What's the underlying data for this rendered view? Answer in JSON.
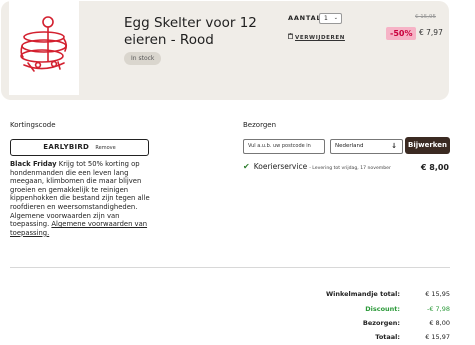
{
  "cart_item": {
    "product_name": "Egg Skelter voor 12 eieren - Rood",
    "stock_label": "In stock",
    "quantity_label": "AANTAL",
    "quantity_value": "1",
    "remove_label": "VERWIJDEREN",
    "old_price": "€ 15,95",
    "discount_badge": "-50%",
    "new_price": "€ 7,97",
    "image_icon": "egg-skelter-product-image",
    "image_color": "#d3202f"
  },
  "coupon": {
    "heading": "Kortingscode",
    "code": "EARLYBIRD",
    "remove_label": "Remove",
    "promo_bold": "Black Friday",
    "promo_text": " Krijg tot 50% korting op hondenmanden die een leven lang meegaan, klimbomen die maar blijven groeien en gemakkelijk te reinigen kippenhokken die bestand zijn tegen alle roofdieren en weersomstandigheden. Algemene voorwaarden zijn van toepassing. ",
    "promo_link": "Algemene voorwaarden van toepassing."
  },
  "shipping": {
    "heading": "Bezorgen",
    "postcode_placeholder": "Vul a.u.b. uw postcode in",
    "country": "Nederland",
    "update_label": "Bijwerken",
    "option_name": "Koerierservice",
    "option_detail": "- Levering tot vrijdag, 17 november",
    "option_price": "€ 8,00"
  },
  "totals": {
    "subtotal_label": "Winkelmandje total:",
    "subtotal_value": "€ 15,95",
    "discount_label": "Discount:",
    "discount_value": "-€ 7,98",
    "delivery_label": "Bezorgen:",
    "delivery_value": "€ 8,00",
    "total_label": "Totaal:",
    "total_value": "€ 15,97"
  },
  "colors": {
    "card_bg": "#f0ede8",
    "discount_badge_bg": "#f6b3c6",
    "discount_badge_text": "#c9003d",
    "button_bg": "#3b2a22",
    "discount_green": "#2c9a3a"
  }
}
